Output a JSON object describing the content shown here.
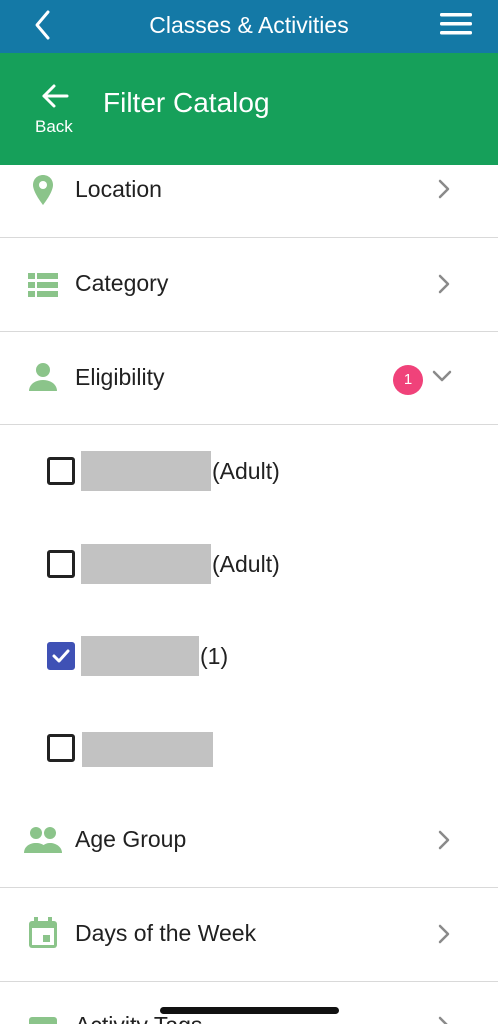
{
  "topbar": {
    "title": "Classes & Activities",
    "back_icon": "chevron-left-icon",
    "menu_icon": "hamburger-menu-icon"
  },
  "header": {
    "back_label": "Back",
    "title": "Filter Catalog"
  },
  "filters": [
    {
      "label": "Location",
      "icon": "location-pin-icon"
    },
    {
      "label": "Category",
      "icon": "list-icon"
    },
    {
      "label": "Eligibility",
      "icon": "person-icon",
      "badge": "1",
      "expanded": true
    },
    {
      "label": "Age Group",
      "icon": "people-icon"
    },
    {
      "label": "Days of the Week",
      "icon": "calendar-icon"
    },
    {
      "label": "Activity Tags",
      "icon": "tag-icon"
    }
  ],
  "eligibility_options": [
    {
      "suffix": "(Adult)",
      "checked": false
    },
    {
      "suffix": "(Adult)",
      "checked": false
    },
    {
      "suffix": "(1)",
      "checked": true
    },
    {
      "suffix": "",
      "checked": false
    }
  ],
  "colors": {
    "topbar": "#1479a6",
    "header": "#16a05a",
    "icon": "#8bc48a",
    "badge": "#f0427a",
    "checkbox_checked": "#3f51b5"
  }
}
